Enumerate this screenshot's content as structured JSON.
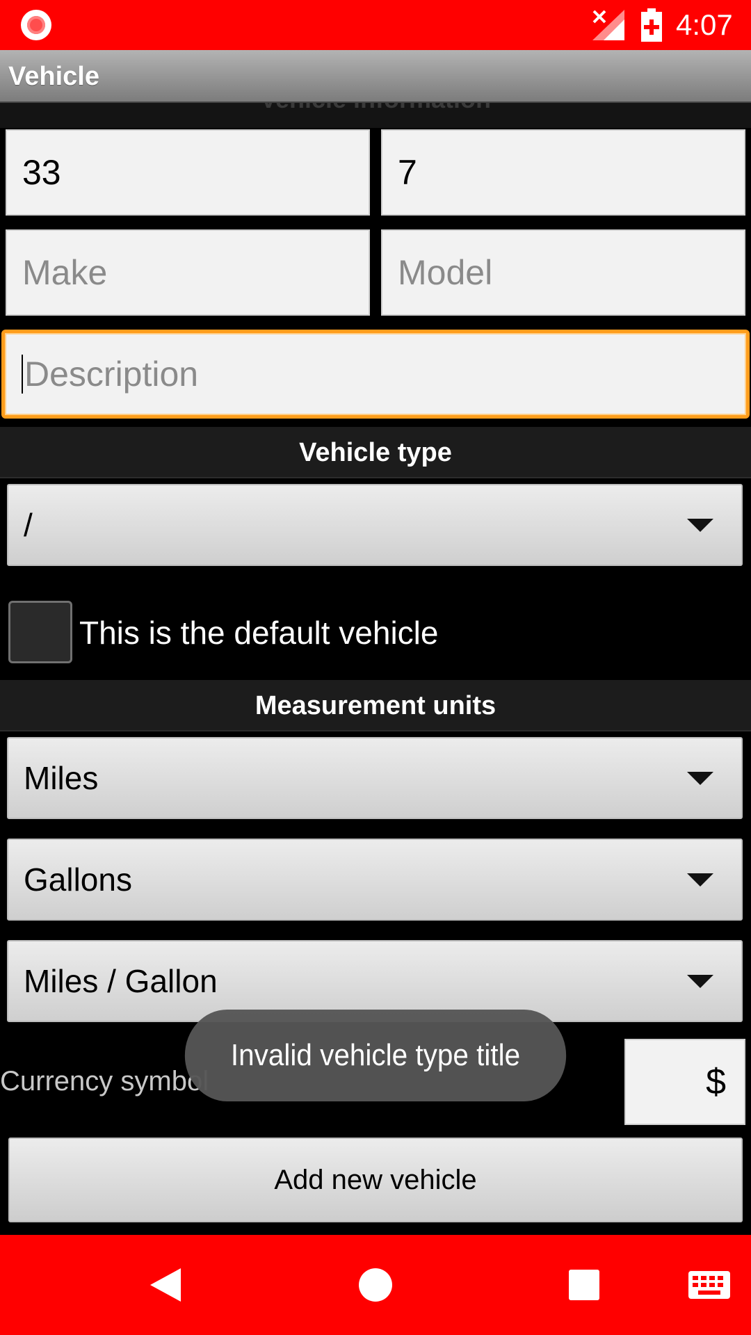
{
  "status_bar": {
    "time": "4:07",
    "icons": [
      "screen-record-icon",
      "no-signal-icon",
      "battery-charging-icon"
    ],
    "background": "#ff0000"
  },
  "action_bar": {
    "title": "Vehicle"
  },
  "section_top": {
    "label": "Vehicle information"
  },
  "fields": {
    "field1_value": "33",
    "field2_value": "7",
    "make_placeholder": "Make",
    "model_placeholder": "Model",
    "description_placeholder": "Description"
  },
  "vehicle_type": {
    "header": "Vehicle type",
    "selected": "/"
  },
  "default_vehicle": {
    "label": "This is the default vehicle",
    "checked": false
  },
  "measurement_units": {
    "header": "Measurement units",
    "distance": "Miles",
    "volume": "Gallons",
    "consumption": "Miles / Gallon"
  },
  "currency": {
    "label": "Currency symbol",
    "value": "$"
  },
  "toast": {
    "message": "Invalid vehicle type title"
  },
  "buttons": {
    "add_label": "Add new vehicle"
  },
  "nav_bar": {
    "icons": [
      "back-icon",
      "home-icon",
      "recents-icon",
      "keyboard-icon"
    ],
    "background": "#ff0000"
  },
  "colors": {
    "accent_focus": "#ff9d1c",
    "background": "#000000"
  }
}
